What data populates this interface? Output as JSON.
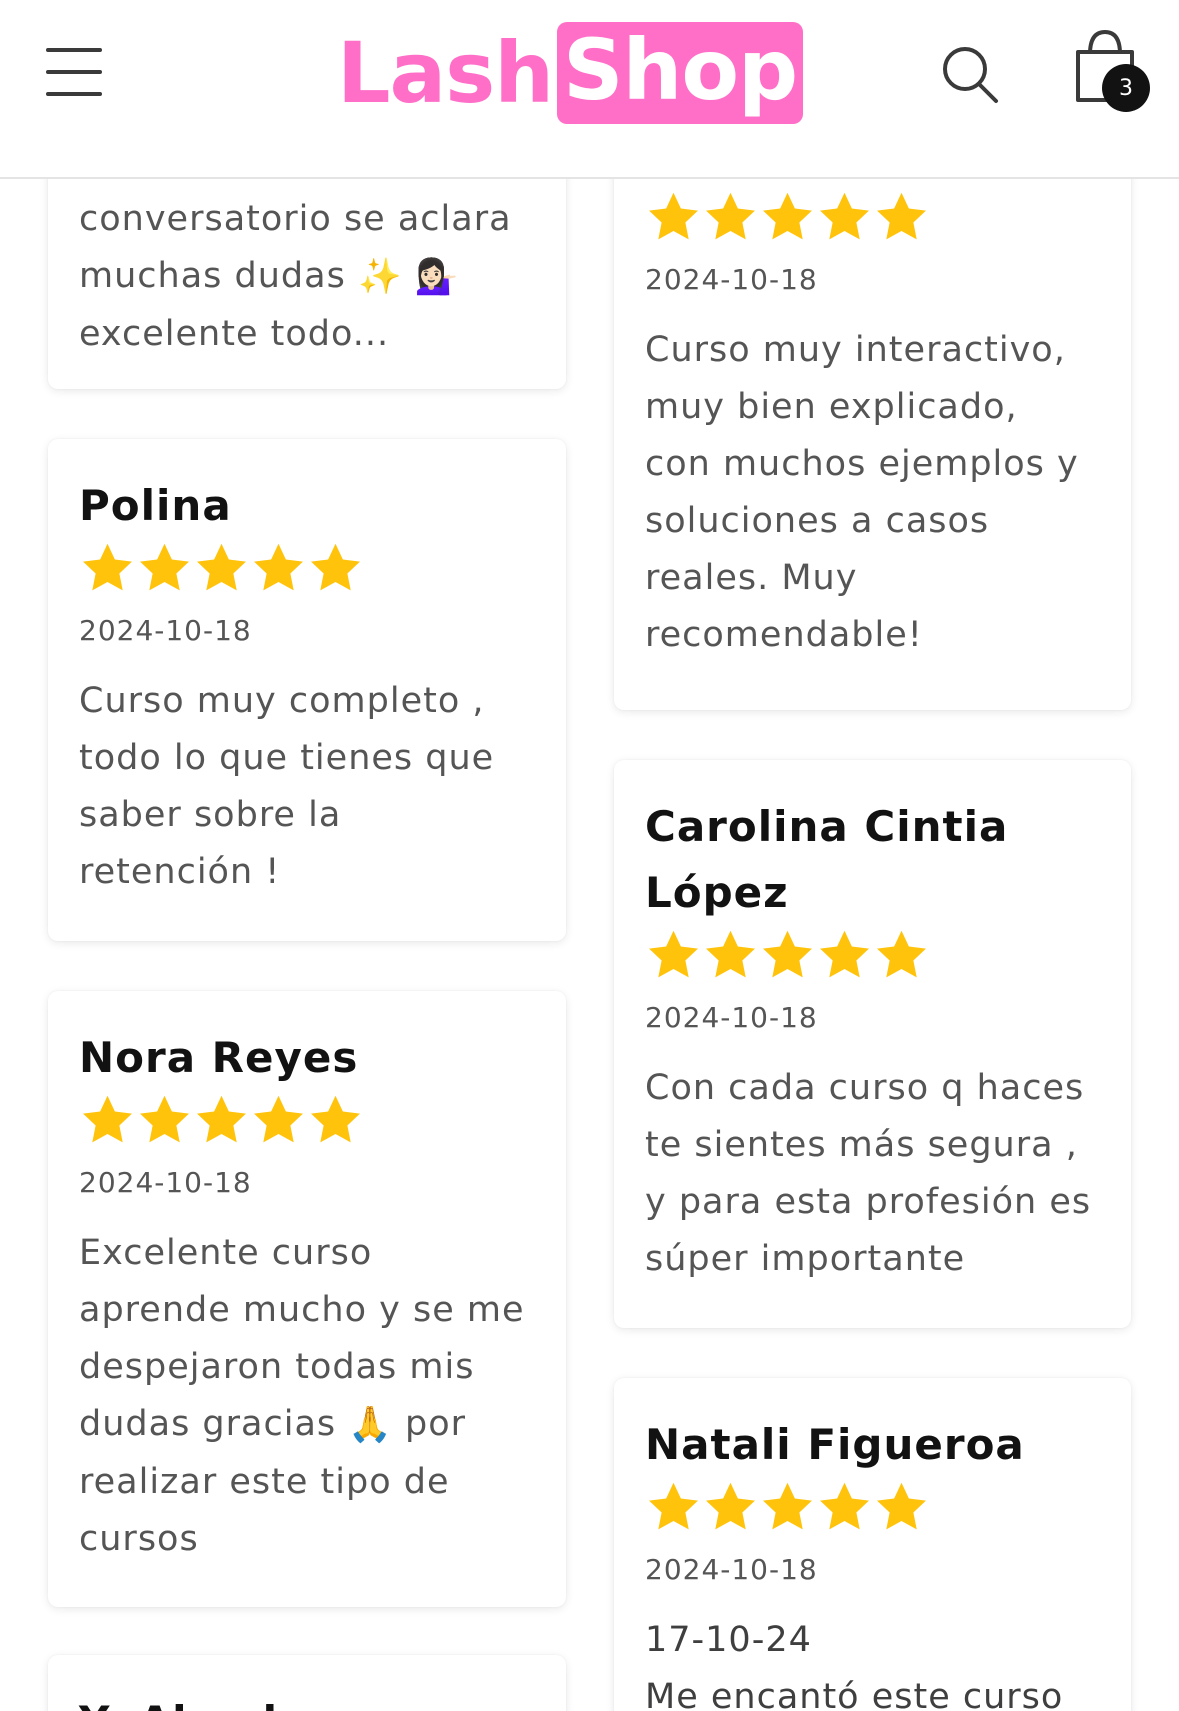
{
  "header": {
    "logo_part1": "Lash",
    "logo_part2": "Shop",
    "cart_count": "3",
    "colors": {
      "brand_pink": "#ff6fc8",
      "badge": "#121212"
    },
    "icons": [
      "menu-icon",
      "search-icon",
      "cart-icon"
    ]
  },
  "reviews": [
    {
      "text_partial_top": "conversatorio se aclara\nmuchas dudas",
      "text_partial_end": "excelente todo..."
    },
    {
      "rating": 5,
      "date": "2024-10-18",
      "text": "Curso muy interactivo,\nmuy bien explicado,\ncon muchos ejemplos y\nsoluciones a casos\nreales. Muy\nrecomendable!"
    },
    {
      "name": "Polina",
      "rating": 5,
      "date": "2024-10-18",
      "text": "Curso muy completo ,\ntodo lo que tienes que\nsaber sobre la\nretención !"
    },
    {
      "name": "Carolina Cintia\nLópez",
      "rating": 5,
      "date": "2024-10-18",
      "text": "Con cada curso q haces\nte sientes más segura ,\ny para esta profesión es\nsúper importante"
    },
    {
      "name": "Nora Reyes",
      "rating": 5,
      "date": "2024-10-18",
      "text_part1": "Excelente curso\naprende mucho y se me\ndespejaron todas mis\ndudas gracias",
      "text_part2": "por\nrealizar este tipo de\ncursos"
    },
    {
      "name": "Natali Figueroa",
      "rating": 5,
      "date": "2024-10-18",
      "text": "17-10-24\nMe encantó este curso"
    },
    {
      "name_partial": "Y   Al        l"
    }
  ],
  "star_color": "#ffc30b"
}
